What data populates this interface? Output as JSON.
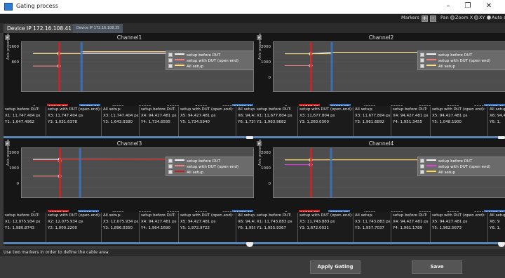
{
  "window": {
    "title": "Gating process",
    "minimize": "–",
    "maximize": "❐",
    "close": "✕"
  },
  "header": {
    "device_label": "Device IP 172.16.108.41",
    "markers_label": "Markers",
    "markers_add": "+",
    "markers_remove": "-",
    "mode_pan": "Pan",
    "mode_zoom_x": "Zoom X",
    "mode_xy": "XY",
    "auto_label": "Auto s"
  },
  "tabs": [
    {
      "label": "Device IP 172.16.108.41",
      "active": true
    },
    {
      "label": "Device IP 172.16.108.35",
      "active": false
    }
  ],
  "colors": {
    "setup_before": "#f4f4ff",
    "setup_with_dut": "#f08080",
    "all_setup": "#ffe08a",
    "marker_red": "#d32222",
    "marker_blue": "#3a75c4",
    "background": "#3a3a3a"
  },
  "panels": [
    {
      "title": "Channel1",
      "yaxis_label": "Axis properties",
      "yticks": [
        "1600",
        "800"
      ],
      "xticks": [
        "0",
        "30000",
        "40000",
        "50000",
        "60000",
        "70000",
        "80000",
        "9"
      ],
      "x_unit": "ps",
      "marker1": "11748.39",
      "marker2": "21770.33",
      "end_label": "94428.45",
      "legend": [
        "setup before DUT",
        "setup with DUT (open end)",
        "All setup"
      ],
      "legend_colors": [
        "#f4f4ff",
        "#f08080",
        "#ffe08a"
      ],
      "chart_data": {
        "type": "line",
        "xlim": [
          0,
          94428.45
        ],
        "ylim": [
          0,
          2000
        ],
        "series": [
          {
            "name": "setup before DUT",
            "x": [
              0,
              11748.39,
              11748.39,
              21770.33,
              94428.45
            ],
            "y": [
              1648,
              1648,
              1648,
              1648,
              1648
            ]
          },
          {
            "name": "setup with DUT (open end)",
            "x": [
              0,
              11748.39,
              11748.39,
              21770.33,
              21770.33,
              94428.45
            ],
            "y": [
              1032,
              1032,
              1648,
              1648,
              1735,
              1735
            ]
          },
          {
            "name": "All setup",
            "x": [
              0,
              11748.39,
              11748.39,
              21770.33,
              21770.33,
              94428.45
            ],
            "y": [
              1648,
              1648,
              1643,
              1643,
              1735,
              1735
            ]
          }
        ]
      },
      "readouts": [
        {
          "h": "setup before DUT:",
          "a": "X1: 11,747.404 ps",
          "b": "Y1: 1,647.4962"
        },
        {
          "h": "setup with DUT (open end):",
          "a": "X3: 11,747.404 ps",
          "b": "Y3: 1,031.6378"
        },
        {
          "h": "All setup:",
          "a": "X3: 11,747.404 ps",
          "b": "Y3: 1,643.0380"
        },
        {
          "h": "setup before DUT:",
          "a": "X4: 94,427.481 ps",
          "b": "Y4: 1,734.6595"
        },
        {
          "h": "setup with DUT (open end):",
          "a": "X5: 94,427.481 ps",
          "b": "Y5: 1,734.5940"
        },
        {
          "h": "All setup:",
          "a": "X6: 94,47",
          "b": "Y6: 1,737"
        }
      ]
    },
    {
      "title": "Channel2",
      "yaxis_label": "Axis properties",
      "yticks": [
        "2000",
        "1000",
        "0"
      ],
      "xticks": [
        "0",
        "30000",
        "40000",
        "50000",
        "60000",
        "70000",
        "80000",
        "9"
      ],
      "x_unit": "ps",
      "marker1": "11703.63",
      "marker2": "21076.76",
      "end_label": "94428.45",
      "legend": [
        "setup before DUT",
        "setup with DUT (open end)",
        "All setup"
      ],
      "legend_colors": [
        "#f4f4ff",
        "#f08080",
        "#ffe08a"
      ],
      "chart_data": {
        "type": "line",
        "xlim": [
          0,
          94428.45
        ],
        "ylim": [
          0,
          2400
        ],
        "series": [
          {
            "name": "setup before DUT",
            "x": [
              0,
              11703.63,
              11703.63,
              21076.76,
              94428.45
            ],
            "y": [
              1964,
              1964,
              1964,
              2050,
              2050
            ]
          },
          {
            "name": "setup with DUT (open end)",
            "x": [
              0,
              11703.63,
              11703.63,
              21076.76,
              21076.76,
              94428.45
            ],
            "y": [
              1260,
              1260,
              1964,
              1964,
              2050,
              2050
            ]
          },
          {
            "name": "All setup",
            "x": [
              0,
              11703.63,
              11703.63,
              21076.76,
              21076.76,
              94428.45
            ],
            "y": [
              1962,
              1962,
              1962,
              1962,
              2048,
              2048
            ]
          }
        ]
      },
      "readouts": [
        {
          "h": "setup before DUT:",
          "a": "X1: 11,677.804 ps",
          "b": "Y1: 1,963.9682"
        },
        {
          "h": "setup with DUT (open end):",
          "a": "X3: 11,677.804 ps",
          "b": "Y3: 1,260.0300"
        },
        {
          "h": "All setup:",
          "a": "X3: 11,677.804 ps",
          "b": "Y3: 1,961.6892"
        },
        {
          "h": "setup before DUT:",
          "a": "X4: 94,427.481 ps",
          "b": "Y4: 1,951.3455"
        },
        {
          "h": "setup with DUT (open end):",
          "a": "X5: 94,427.481 ps",
          "b": "Y5: 1,048.1900"
        },
        {
          "h": "All setup:",
          "a": "X6: 94,4",
          "b": "Y6: 1,"
        }
      ]
    },
    {
      "title": "Channel3",
      "yaxis_label": "Axis properties",
      "yticks": [
        "2000",
        "1000",
        "0"
      ],
      "xticks": [
        "0",
        "30000",
        "40000",
        "50000",
        "60000",
        "70000",
        "80000",
        "9"
      ],
      "x_unit": "ps",
      "marker1": "12073.07",
      "marker2": "21115.64",
      "end_label": "94428.45",
      "legend": [
        "setup before DUT",
        "setup with DUT (open end)",
        "All setup"
      ],
      "legend_colors": [
        "#f4f4ff",
        "#f08080",
        "#c81e1e"
      ],
      "chart_data": {
        "type": "line",
        "xlim": [
          0,
          94428.45
        ],
        "ylim": [
          0,
          2400
        ],
        "series": [
          {
            "name": "setup before DUT",
            "x": [
              0,
              12073.07,
              12073.07,
              21115.64,
              94428.45
            ],
            "y": [
              1981,
              1981,
              1981,
              1981,
              1981
            ]
          },
          {
            "name": "setup with DUT (open end)",
            "x": [
              0,
              12073.07,
              12073.07,
              21115.64,
              94428.45
            ],
            "y": [
              1000,
              1000,
              1981,
              1981,
              1981
            ]
          },
          {
            "name": "All setup",
            "x": [
              0,
              12073.07,
              12073.07,
              21115.64,
              94428.45
            ],
            "y": [
              1897,
              1897,
              1964,
              1964,
              1973
            ]
          }
        ]
      },
      "readouts": [
        {
          "h": "setup before DUT:",
          "a": "X1: 12,075.934 ps",
          "b": "Y1: 1,980.8743"
        },
        {
          "h": "setup with DUT (open end):",
          "a": "X2: 12,075.934 ps",
          "b": "Y2: 1,000.2200"
        },
        {
          "h": "All setup:",
          "a": "X3: 12,075.934 ps",
          "b": "Y3: 1,896.0350"
        },
        {
          "h": "setup before DUT:",
          "a": "X4: 94,427.481 ps",
          "b": "Y4: 1,964.1690"
        },
        {
          "h": "setup with DUT (open end):",
          "a": "X5: 94,427.481 ps",
          "b": "Y5: 1,972.9722"
        },
        {
          "h": "All setup:",
          "a": "X6: 94,47",
          "b": "Y6: 1,959"
        }
      ]
    },
    {
      "title": "Channel4",
      "yaxis_label": "Axis properties",
      "yticks": [
        "2000",
        "1000",
        "0"
      ],
      "xticks": [
        "0",
        "30000",
        "40000",
        "50000",
        "60000",
        "70000",
        "80000",
        "9"
      ],
      "x_unit": "ps",
      "marker1": "11703.63",
      "marker2": "20742.45",
      "end_label": "94428.45",
      "legend": [
        "setup before DUT",
        "setup with DUT (open end)",
        "All setup"
      ],
      "legend_colors": [
        "#f4f4ff",
        "#e040e0",
        "#ffd84a"
      ],
      "chart_data": {
        "type": "line",
        "xlim": [
          0,
          94428.45
        ],
        "ylim": [
          0,
          2400
        ],
        "series": [
          {
            "name": "setup before DUT",
            "x": [
              0,
              11703.63,
              11703.63,
              20742.45,
              94428.45
            ],
            "y": [
              1956,
              1956,
              1956,
              1962,
              1962
            ]
          },
          {
            "name": "setup with DUT (open end)",
            "x": [
              0,
              11703.63,
              11703.63,
              20742.45,
              20742.45,
              94428.45
            ],
            "y": [
              1672,
              1672,
              1956,
              1956,
              1963,
              1963
            ]
          },
          {
            "name": "All setup",
            "x": [
              0,
              11703.63,
              11703.63,
              20742.45,
              94428.45
            ],
            "y": [
              1958,
              1958,
              1958,
              1962,
              1962
            ]
          }
        ]
      },
      "readouts": [
        {
          "h": "setup before DUT:",
          "a": "X1: 11,743.883 ps",
          "b": "Y1: 1,955.9367"
        },
        {
          "h": "setup with DUT (open end):",
          "a": "X3: 11,743.883 ps",
          "b": "Y3: 1,672.0031"
        },
        {
          "h": "All setup:",
          "a": "X3: 11,743.883 ps",
          "b": "Y3: 1,957.7037"
        },
        {
          "h": "setup before DUT:",
          "a": "X4: 94,427.481 ps",
          "b": "Y4: 1,961.1789"
        },
        {
          "h": "setup with DUT (open end):",
          "a": "X5: 94,427.481 ps",
          "b": "Y5: 1,962.5673"
        },
        {
          "h": "All setup:",
          "a": "X6: 9",
          "b": "Y6: 1,"
        }
      ]
    }
  ],
  "status": {
    "message": "Use two markers in order to define the cable area."
  },
  "actions": {
    "apply_label": "Apply Gating",
    "save_label": "Save"
  }
}
